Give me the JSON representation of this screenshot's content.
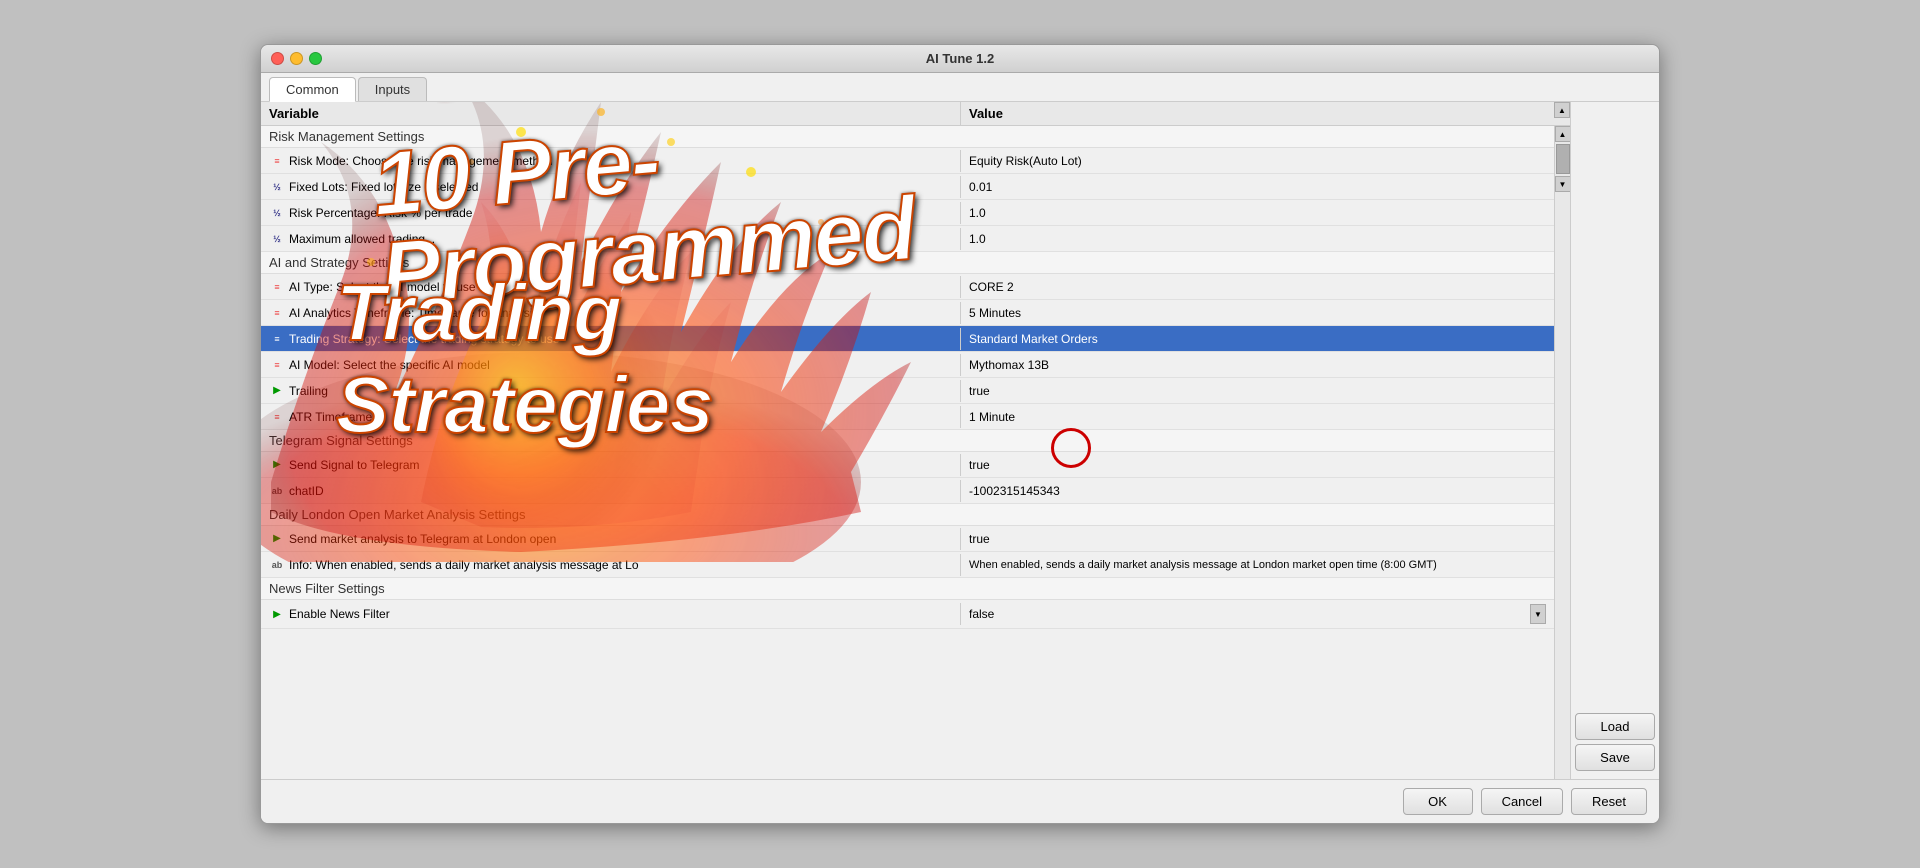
{
  "window": {
    "title": "AI Tune 1.2",
    "traffic_lights": [
      "red",
      "yellow",
      "green"
    ]
  },
  "tabs": [
    {
      "id": "common",
      "label": "Common",
      "active": true
    },
    {
      "id": "inputs",
      "label": "Inputs",
      "active": false
    }
  ],
  "table": {
    "headers": {
      "variable": "Variable",
      "value": "Value"
    },
    "sections": [
      {
        "title": "Risk Management Settings",
        "rows": [
          {
            "icon": "eq",
            "variable": "Risk Mode: Choose the risk management method",
            "value": "Equity Risk(Auto Lot)"
          },
          {
            "icon": "half",
            "variable": "Fixed Lots: Fixed lot size if selected",
            "value": "0.01"
          },
          {
            "icon": "half",
            "variable": "Risk Percentage: Risk % per trade",
            "value": "1.0"
          },
          {
            "icon": "half",
            "variable": "Maximum allowed trading...",
            "value": "1.0"
          }
        ]
      },
      {
        "title": "AI and Strategy Settings",
        "rows": [
          {
            "icon": "eq",
            "variable": "AI Type: Select the AI model to use",
            "value": "CORE 2"
          },
          {
            "icon": "eq",
            "variable": "AI Analytics Timeframe: Timeframe for analysis",
            "value": "5 Minutes"
          },
          {
            "icon": "eq",
            "variable": "Trading Strategy: Select the trading strategy to use",
            "value": "Standard Market Orders",
            "selected": true
          },
          {
            "icon": "eq",
            "variable": "AI Model: Select the specific AI model",
            "value": "Mythomax 13B"
          }
        ]
      },
      {
        "title": "",
        "rows": [
          {
            "icon": "arrow",
            "variable": "Trailing",
            "value": "true"
          },
          {
            "icon": "eq",
            "variable": "ATR Timeframe",
            "value": "1 Minute"
          }
        ]
      },
      {
        "title": "Telegram Signal Settings",
        "rows": [
          {
            "icon": "arrow",
            "variable": "Send Signal to Telegram",
            "value": "true"
          },
          {
            "icon": "ab",
            "variable": "chatID",
            "value": "-1002315145343"
          }
        ]
      },
      {
        "title": "Daily London Open Market Analysis Settings",
        "rows": [
          {
            "icon": "arrow",
            "variable": "Send market analysis to Telegram at London open",
            "value": "true"
          },
          {
            "icon": "ab",
            "variable": "Info: When enabled, sends a daily market analysis message at Lo",
            "value": "When enabled, sends a daily market analysis message at London market open time (8:00 GMT)"
          }
        ]
      },
      {
        "title": "News Filter Settings",
        "rows": [
          {
            "icon": "arrow",
            "variable": "Enable News Filter",
            "value": "false",
            "dropdown": true
          }
        ]
      }
    ]
  },
  "fire_overlay": {
    "line1": "10 Pre-Programmed",
    "line2": "Trading Strategies"
  },
  "sidebar_buttons": {
    "load": "Load",
    "save": "Save"
  },
  "bottom_buttons": {
    "ok": "OK",
    "cancel": "Cancel",
    "reset": "Reset"
  }
}
